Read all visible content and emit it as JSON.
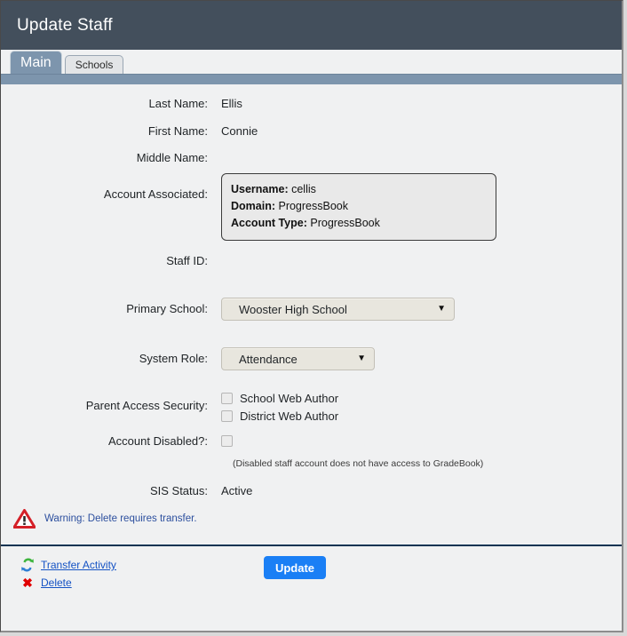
{
  "window": {
    "title": "Update Staff"
  },
  "tabs": [
    {
      "label": "Main",
      "active": true
    },
    {
      "label": "Schools",
      "active": false
    }
  ],
  "form": {
    "last_name": {
      "label": "Last Name:",
      "value": "Ellis"
    },
    "first_name": {
      "label": "First Name:",
      "value": "Connie"
    },
    "middle_name": {
      "label": "Middle Name:",
      "value": ""
    },
    "account_associated": {
      "label": "Account Associated:",
      "username_label": "Username:",
      "username_value": "cellis",
      "domain_label": "Domain:",
      "domain_value": "ProgressBook",
      "account_type_label": "Account Type:",
      "account_type_value": "ProgressBook"
    },
    "staff_id": {
      "label": "Staff ID:",
      "value": ""
    },
    "primary_school": {
      "label": "Primary School:",
      "selected": "Wooster High School",
      "arrow": "▼"
    },
    "system_role": {
      "label": "System Role:",
      "selected": "Attendance",
      "arrow": "▼"
    },
    "parent_access_security": {
      "label": "Parent Access Security:",
      "options": [
        {
          "label": "School Web Author",
          "checked": false
        },
        {
          "label": "District Web Author",
          "checked": false
        }
      ]
    },
    "account_disabled": {
      "label": "Account Disabled?:",
      "checked": false,
      "hint": "(Disabled staff account does not have access to GradeBook)"
    },
    "sis_status": {
      "label": "SIS Status:",
      "value": "Active"
    }
  },
  "warning": {
    "icon": "warning-triangle-icon",
    "text": "Warning: Delete requires transfer."
  },
  "footer": {
    "transfer_activity": {
      "label": "Transfer Activity",
      "icon": "sync-arrows-icon"
    },
    "delete": {
      "label": "Delete",
      "icon": "red-x-icon"
    },
    "update_button": {
      "label": "Update"
    }
  },
  "colors": {
    "titlebar": "#434f5c",
    "tab_active": "#7d95ad",
    "tab_underline": "#7d95ad",
    "body_bg": "#f0f1f2",
    "accent_button": "#1a7ff5",
    "link": "#1452c4",
    "warning_text": "#2c4f9e",
    "warning_icon": "#d42028",
    "divider": "#0d3352"
  }
}
